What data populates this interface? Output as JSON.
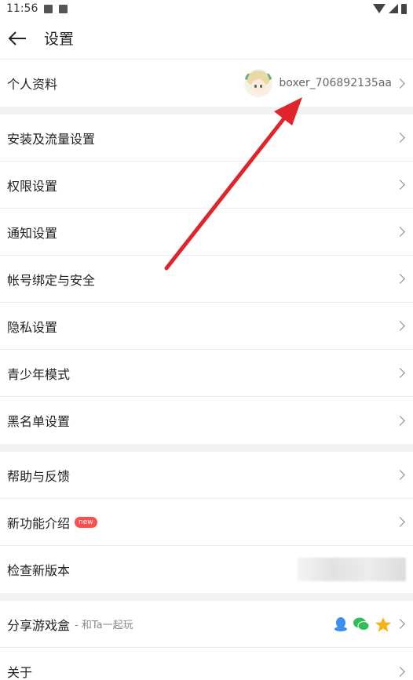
{
  "status": {
    "time": "11:56"
  },
  "header": {
    "title": "设置"
  },
  "profile": {
    "label": "个人资料",
    "username": "boxer_706892135aa"
  },
  "group1": [
    {
      "label": "安装及流量设置"
    },
    {
      "label": "权限设置"
    },
    {
      "label": "通知设置"
    },
    {
      "label": "帐号绑定与安全"
    },
    {
      "label": "隐私设置"
    },
    {
      "label": "青少年模式"
    },
    {
      "label": "黑名单设置"
    }
  ],
  "group2": {
    "help": "帮助与反馈",
    "features": "新功能介绍",
    "new_badge": "new",
    "check_version": "检查新版本"
  },
  "group3": {
    "share": "分享游戏盒",
    "share_sub": "- 和Ta一起玩",
    "about": "关于"
  },
  "colors": {
    "accent_red": "#e0242b",
    "qq_blue": "#3b8ff0",
    "wechat_green": "#2fbf5a",
    "star_orange": "#f6b21a"
  },
  "icons": [
    "back-arrow-icon",
    "chevron-right-icon",
    "qq-icon",
    "wechat-icon",
    "qzone-star-icon"
  ]
}
